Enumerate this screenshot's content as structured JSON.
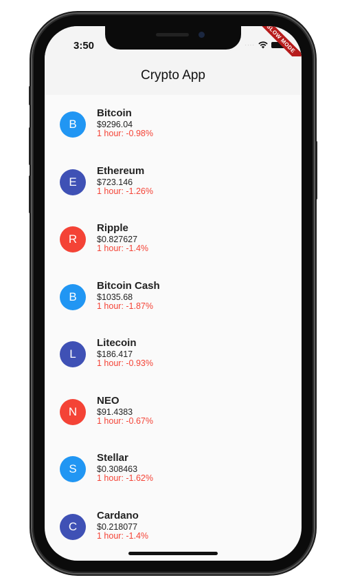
{
  "status_bar": {
    "time": "3:50",
    "signal_dots": "····",
    "icons": [
      "wifi-icon",
      "battery-icon"
    ]
  },
  "debug_banner": {
    "label": "SLOW MODE",
    "color": "#b71c1c"
  },
  "app_bar": {
    "title": "Crypto App"
  },
  "colors": {
    "blue": "#2196f3",
    "indigo": "#3f51b5",
    "red": "#f44336",
    "negative_change": "#f44336"
  },
  "coins": [
    {
      "initial": "B",
      "name": "Bitcoin",
      "price": "$9296.04",
      "change": "1 hour: -0.98%",
      "color": "#2196f3"
    },
    {
      "initial": "E",
      "name": "Ethereum",
      "price": "$723.146",
      "change": "1 hour: -1.26%",
      "color": "#3f51b5"
    },
    {
      "initial": "R",
      "name": "Ripple",
      "price": "$0.827627",
      "change": "1 hour: -1.4%",
      "color": "#f44336"
    },
    {
      "initial": "B",
      "name": "Bitcoin Cash",
      "price": "$1035.68",
      "change": "1 hour: -1.87%",
      "color": "#2196f3"
    },
    {
      "initial": "L",
      "name": "Litecoin",
      "price": "$186.417",
      "change": "1 hour: -0.93%",
      "color": "#3f51b5"
    },
    {
      "initial": "N",
      "name": "NEO",
      "price": "$91.4383",
      "change": "1 hour: -0.67%",
      "color": "#f44336"
    },
    {
      "initial": "S",
      "name": "Stellar",
      "price": "$0.308463",
      "change": "1 hour: -1.62%",
      "color": "#2196f3"
    },
    {
      "initial": "C",
      "name": "Cardano",
      "price": "$0.218077",
      "change": "1 hour: -1.4%",
      "color": "#3f51b5"
    }
  ]
}
